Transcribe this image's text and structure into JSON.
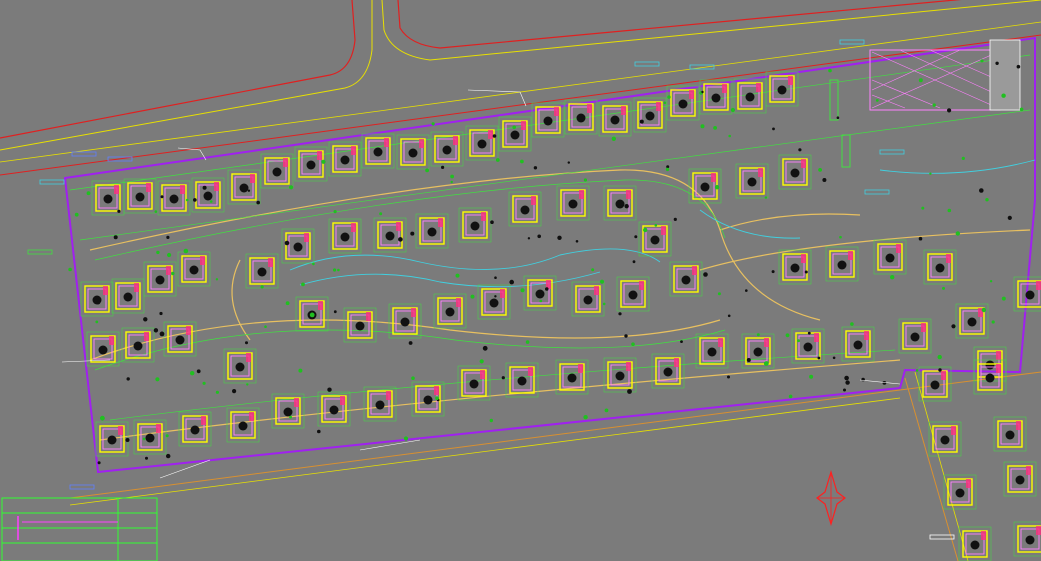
{
  "colors": {
    "background": "#7b7b7b",
    "site_boundary": "#a020f0",
    "road_red": "#e02020",
    "road_yellow": "#e8e000",
    "road_orange": "#d89030",
    "villa_outline": "#ffff00",
    "villa_roof": "#ff80ff",
    "villa_accent": "#ff3080",
    "path_green": "#40e040",
    "water_cyan": "#40d0e0",
    "label_blue": "#6080ff",
    "compass_red": "#ff2020",
    "titleblock_green": "#30ff30"
  },
  "icons": {
    "north_arrow": "north-arrow-icon",
    "villa": "villa-block-icon",
    "tree": "tree-dot-icon"
  },
  "viewport": {
    "title_block_rows": 3
  }
}
